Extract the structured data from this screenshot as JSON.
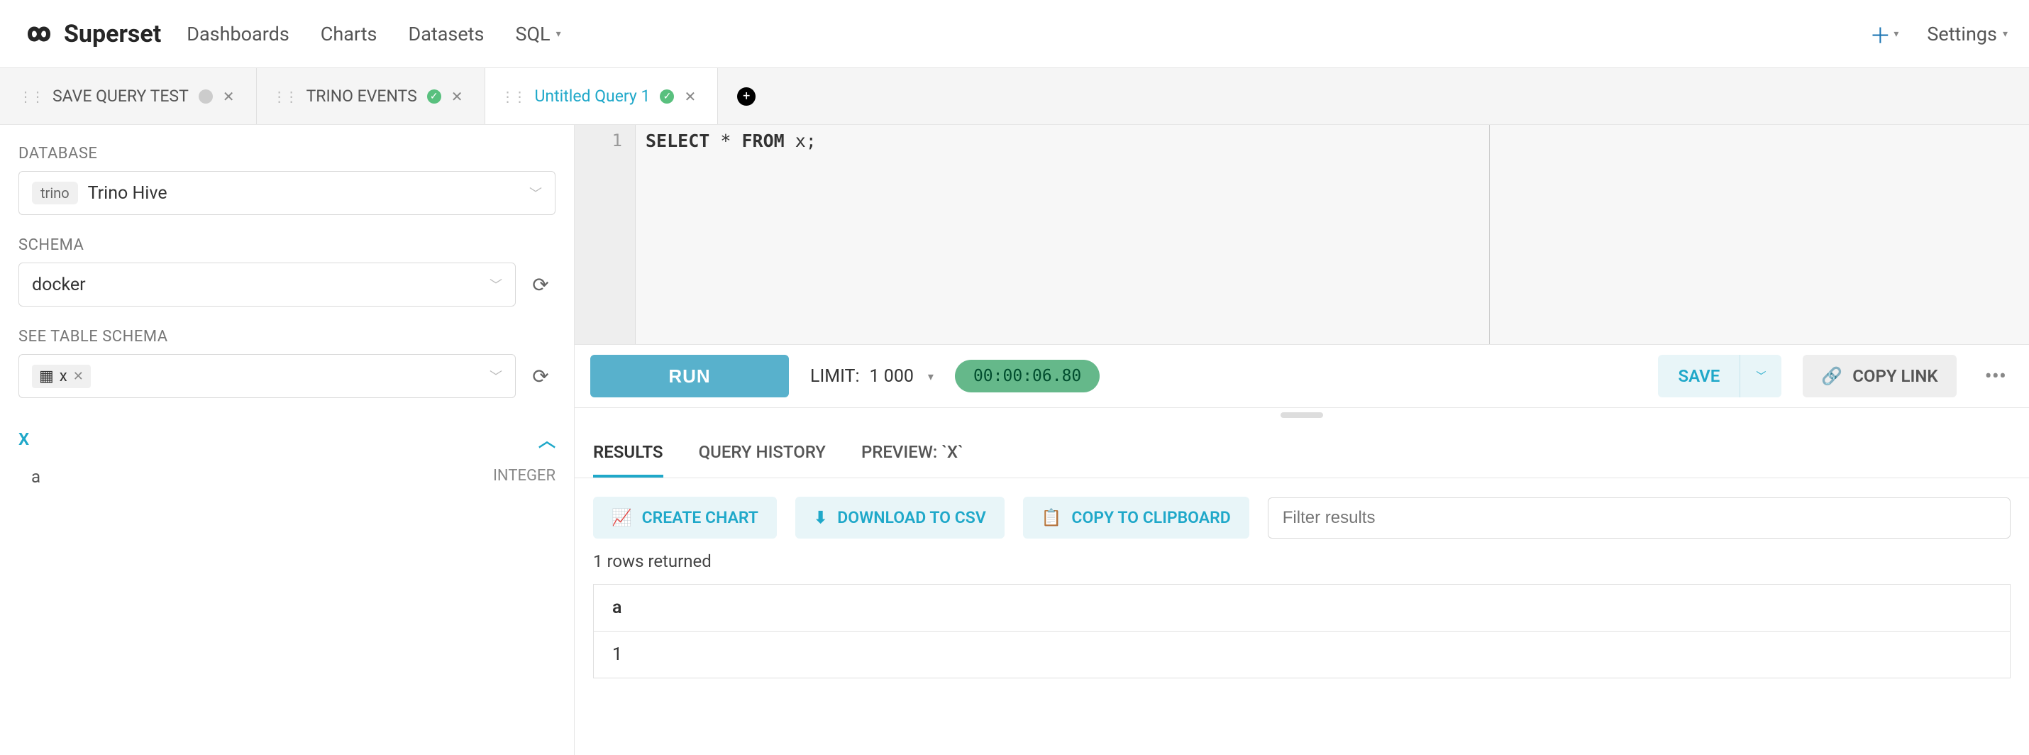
{
  "brand": "Superset",
  "nav": {
    "dashboards": "Dashboards",
    "charts": "Charts",
    "datasets": "Datasets",
    "sql": "SQL",
    "settings": "Settings"
  },
  "tabs": [
    {
      "label": "SAVE QUERY TEST",
      "status": "gray"
    },
    {
      "label": "TRINO EVENTS",
      "status": "green"
    },
    {
      "label": "Untitled Query 1",
      "status": "green",
      "active": true
    }
  ],
  "sidebar": {
    "database_label": "DATABASE",
    "database_engine_tag": "trino",
    "database_value": "Trino Hive",
    "schema_label": "SCHEMA",
    "schema_value": "docker",
    "see_table_label": "SEE TABLE SCHEMA",
    "table_chip": "x",
    "table_name": "X",
    "columns": [
      {
        "name": "a",
        "type": "INTEGER"
      }
    ]
  },
  "editor": {
    "line_number": "1",
    "code_kw1": "SELECT",
    "code_star": " * ",
    "code_kw2": "FROM",
    "code_rest": " x;"
  },
  "toolbar": {
    "run": "RUN",
    "limit_label": "LIMIT:",
    "limit_value": "1 000",
    "elapsed": "00:00:06.80",
    "save": "SAVE",
    "copy_link": "COPY LINK"
  },
  "result_tabs": {
    "results": "RESULTS",
    "history": "QUERY HISTORY",
    "preview": "PREVIEW: `X`"
  },
  "result_actions": {
    "create_chart": "CREATE CHART",
    "download_csv": "DOWNLOAD TO CSV",
    "copy_clip": "COPY TO CLIPBOARD",
    "filter_placeholder": "Filter results"
  },
  "results": {
    "rows_returned": "1 rows returned",
    "header": "a",
    "cell": "1"
  }
}
